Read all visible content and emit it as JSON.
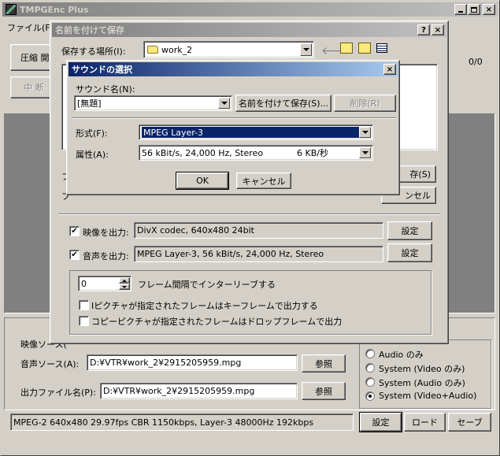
{
  "main_window": {
    "title": "TMPGEnc Plus",
    "menu_file": "ファイル(F)",
    "compress_btn_partial": "圧縮 開",
    "stop_btn_partial": "中 断",
    "counter": "0/0",
    "video_source_label_partial": "映像ソース(",
    "audio_source_label": "音声ソース(A):",
    "audio_source_value": "D:¥VTR¥work_2¥2915205959.mpg",
    "output_file_label": "出力ファイル名(P):",
    "output_file_value": "D:¥VTR¥work_2¥2915205959.mpg",
    "browse_label": "参照",
    "stream_options": [
      "Audio のみ",
      "System (Video のみ)",
      "System (Audio のみ)",
      "System (Video+Audio)"
    ],
    "stream_selected_index": 3,
    "status_text": "MPEG-2 640x480 29.97fps CBR 1150kbps,  Layer-3 48000Hz 192kbps",
    "settings_button": "設定",
    "load_button": "ロード",
    "save_button": "セーブ"
  },
  "save_dialog": {
    "title": "名前を付けて保存",
    "help_glyph": "?",
    "close_glyph": "×",
    "location_label": "保存する場所(I):",
    "location_value": "work_2",
    "save_btn_partial": "存(S)",
    "cancel_btn_partial": "ンセル",
    "left_label_1_partial": "フ",
    "left_label_2_partial": "フ",
    "output_video_label": "映像を出力:",
    "output_video_checked": true,
    "output_video_value": "DivX codec, 640x480 24bit",
    "output_audio_label": "音声を出力:",
    "output_audio_checked": true,
    "output_audio_value": "MPEG Layer-3, 56 kBit/s, 24,000 Hz, Stereo",
    "settings_label": "設定",
    "interleave_value": "0",
    "interleave_label": "フレーム間隔でインターリーブする",
    "keyframe_label": "Iピクチャが指定されたフレームはキーフレームで出力する",
    "keyframe_checked": false,
    "dropframe_label": "コピーピクチャが指定されたフレームはドロップフレームで出力",
    "dropframe_checked": false
  },
  "sound_dialog": {
    "title": "サウンドの選択",
    "close_glyph": "×",
    "name_label": "サウンド名(N):",
    "name_value": "[無題]",
    "save_as_button": "名前を付けて保存(S)...",
    "delete_button": "削除(R)",
    "format_label": "形式(F):",
    "format_value": "MPEG Layer-3",
    "attributes_label": "属性(A):",
    "attributes_value": "56 kBit/s, 24,000 Hz, Stereo",
    "attributes_rate": "6 KB/秒",
    "ok_button": "OK",
    "cancel_button": "キャンセル"
  },
  "colors": {
    "face": "#d4d0c8",
    "active_title": "#0a246a",
    "inactive_title": "#808080",
    "selection": "#0a246a",
    "preview_gray": "#808080"
  }
}
